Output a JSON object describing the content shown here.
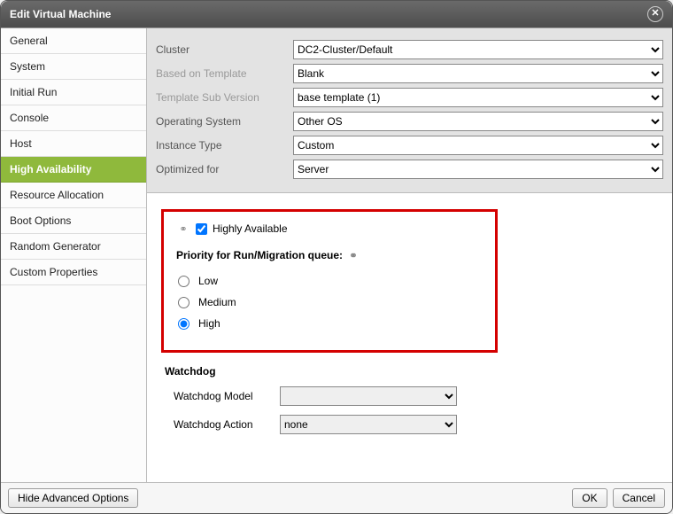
{
  "dialog": {
    "title": "Edit Virtual Machine"
  },
  "sidebar": {
    "items": [
      {
        "label": "General"
      },
      {
        "label": "System"
      },
      {
        "label": "Initial Run"
      },
      {
        "label": "Console"
      },
      {
        "label": "Host"
      },
      {
        "label": "High Availability"
      },
      {
        "label": "Resource Allocation"
      },
      {
        "label": "Boot Options"
      },
      {
        "label": "Random Generator"
      },
      {
        "label": "Custom Properties"
      }
    ],
    "active_index": 5
  },
  "topform": {
    "cluster": {
      "label": "Cluster",
      "value": "DC2-Cluster/Default"
    },
    "template": {
      "label": "Based on Template",
      "value": "Blank"
    },
    "subversion": {
      "label": "Template Sub Version",
      "value": "base template (1)"
    },
    "os": {
      "label": "Operating System",
      "value": "Other OS"
    },
    "instance": {
      "label": "Instance Type",
      "value": "Custom"
    },
    "optimized": {
      "label": "Optimized for",
      "value": "Server"
    }
  },
  "ha": {
    "checkbox_label": "Highly Available",
    "checked": true,
    "priority_title": "Priority for Run/Migration queue:",
    "options": {
      "low": "Low",
      "medium": "Medium",
      "high": "High"
    },
    "selected": "high"
  },
  "watchdog": {
    "title": "Watchdog",
    "model_label": "Watchdog Model",
    "model_value": "",
    "action_label": "Watchdog Action",
    "action_value": "none"
  },
  "footer": {
    "advanced": "Hide Advanced Options",
    "ok": "OK",
    "cancel": "Cancel"
  }
}
